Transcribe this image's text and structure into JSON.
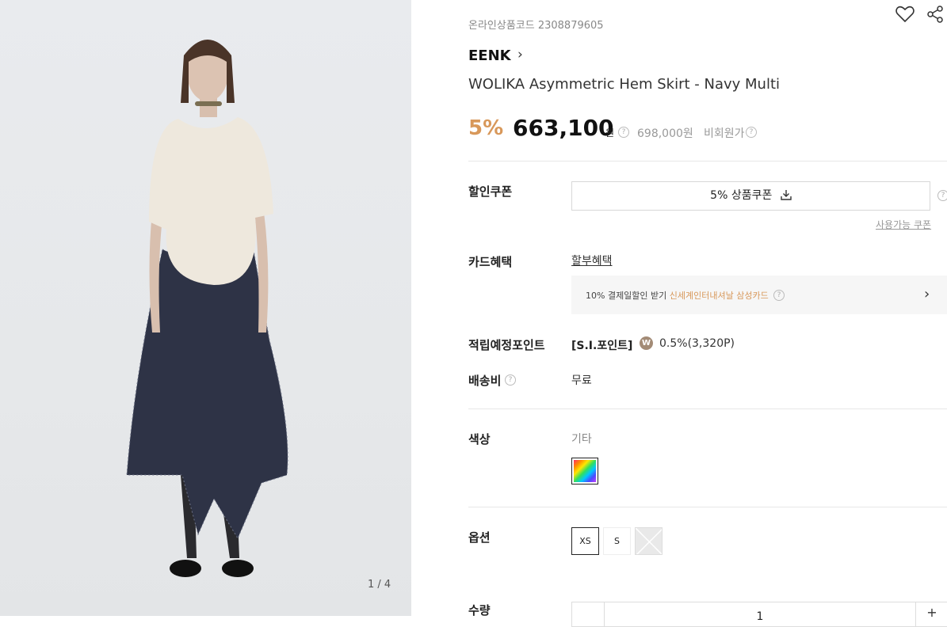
{
  "gallery": {
    "counter": "1 / 4"
  },
  "product": {
    "online_code": "온라인상품코드 2308879605",
    "brand": "EENK",
    "brand_chevron": "›",
    "title": "WOLIKA Asymmetric Hem Skirt - Navy Multi"
  },
  "price": {
    "discount": "5%",
    "sale": "663,100",
    "unit": "원",
    "original": "698,000원",
    "original_label": "비회원가",
    "help": "?"
  },
  "coupon": {
    "label": "할인쿠폰",
    "button": "5% 상품쿠폰",
    "available_link": "사용가능 쿠폰"
  },
  "card": {
    "label": "카드혜택",
    "link": "할부혜택",
    "promo_prefix": "10% 결제일할인 받기",
    "promo_highlight": "신세계인터내셔날 삼성카드",
    "chevron": "›"
  },
  "points": {
    "label": "적립예정포인트",
    "type": "[S.I.포인트]",
    "badge": "W",
    "value": "0.5%(3,320P)"
  },
  "shipping": {
    "label": "배송비",
    "value": "무료"
  },
  "color": {
    "label": "색상",
    "value": "기타"
  },
  "options": {
    "label": "옵션",
    "sizes": [
      "XS",
      "S"
    ]
  },
  "quantity": {
    "label": "수량",
    "value": "1",
    "plus": "+"
  },
  "colors": {
    "accent": "#d8985a",
    "text": "#222222",
    "muted": "#999999",
    "card_bg": "#f6f6f6",
    "si_badge": "#a38b76"
  }
}
